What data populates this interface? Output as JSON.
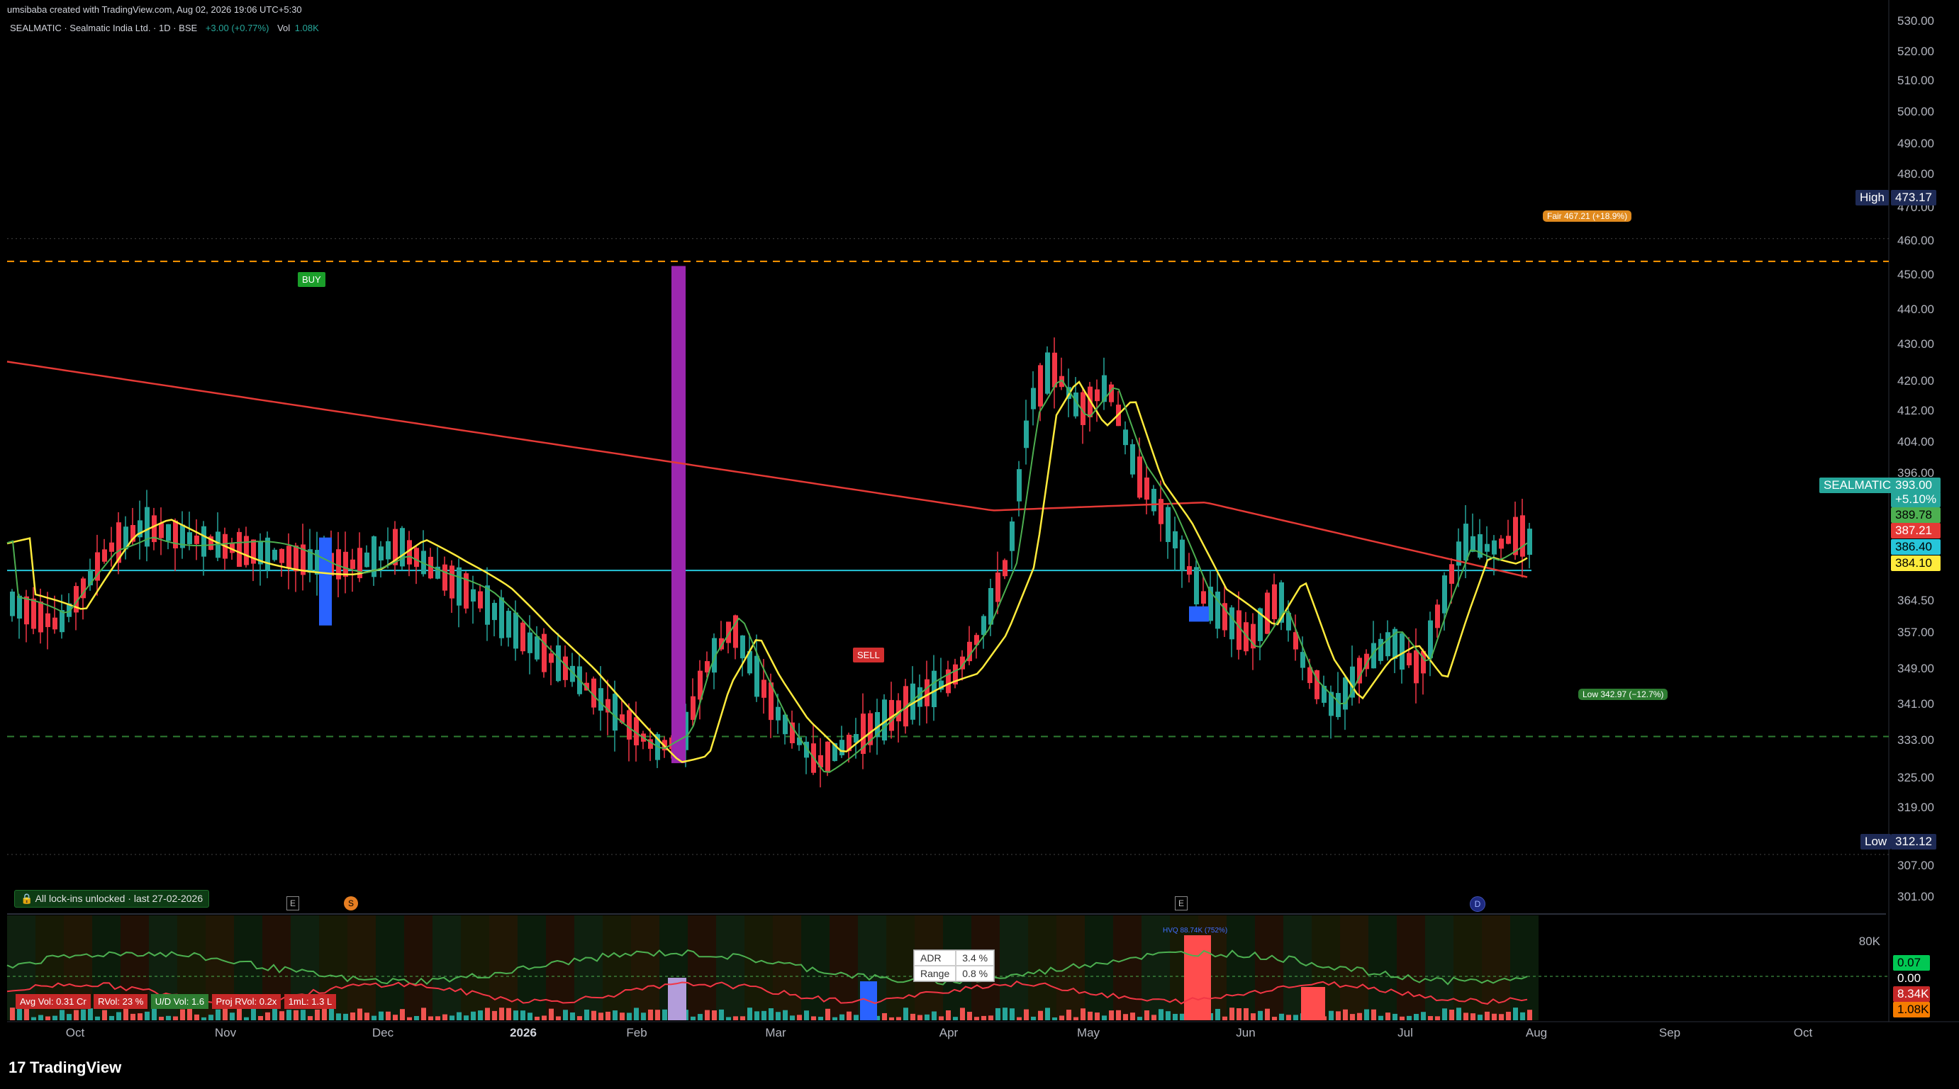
{
  "header": {
    "credit": "umsibaba created with TradingView.com, Aug 02, 2026 19:06 UTC+5:30",
    "symbol": "SEALMATIC · Sealmatic India Ltd. · 1D · BSE",
    "change": "+3.00 (+0.77%)",
    "vol_label": "Vol",
    "vol_value": "1.08K"
  },
  "colors": {
    "up": "#26a69a",
    "down": "#f23645",
    "sma_slow": "#e53935",
    "sma_fast": "#ffeb3b",
    "ema": "#4caf50",
    "hline": "#26c6da",
    "fair": "#ff9800",
    "low_line": "#2e7d32",
    "purple": "#9c27b0",
    "blue": "#2962ff",
    "lavender": "#b39ddb"
  },
  "price_axis": {
    "ticks": [
      "530.00",
      "520.00",
      "510.00",
      "500.00",
      "490.00",
      "480.00",
      "470.00",
      "460.00",
      "450.00",
      "440.00",
      "430.00",
      "420.00",
      "412.00",
      "404.00",
      "396.00",
      "364.50",
      "357.00",
      "349.00",
      "341.00",
      "333.00",
      "325.00",
      "319.00",
      "307.00",
      "301.00"
    ]
  },
  "time_axis": {
    "labels": [
      "Oct",
      "Nov",
      "Dec",
      "2026",
      "Feb",
      "Mar",
      "Apr",
      "May",
      "Jun",
      "Jul",
      "Aug",
      "Sep",
      "Oct"
    ]
  },
  "tags": {
    "high_label": "High",
    "high_value": "473.17",
    "low_label": "Low",
    "low_value": "312.12",
    "sym_label": "SEALMATIC",
    "sym_price": "393.00",
    "sym_change": "+5.10%",
    "ema_value": "389.78",
    "sma_slow_value": "387.21",
    "hline_value": "386.40",
    "sma_fast_value": "384.10",
    "fair": "Fair 467.21 (+18.9%)",
    "low_line": "Low 342.97 (−12.7%)",
    "buy": "BUY",
    "sell": "SELL"
  },
  "events": {
    "lock": "All lock-ins unlocked · last 27-02-2026",
    "earnings": "E",
    "dividend": "S",
    "other": "D"
  },
  "volume_pane": {
    "ticks": [
      "80K",
      "0.07",
      "0.00",
      "8.34K",
      "1.08K"
    ],
    "badges": {
      "avg_vol": "Avg Vol: 0.31 Cr",
      "rvol": "RVol: 23 %",
      "ud_vol": "U/D Vol: 1.6",
      "proj_rvol": "Proj RVol: 0.2x",
      "iml": "1mL: 1.3 L"
    },
    "hvq": "HVQ 88.74K (752%)",
    "adr_label": "ADR",
    "adr_value": "3.4 %",
    "range_label": "Range",
    "range_value": "0.8 %"
  },
  "footer": {
    "brand": "TradingView"
  },
  "chart_data": {
    "type": "line",
    "title": "SEALMATIC · Sealmatic India Ltd. · 1D · BSE",
    "x": [
      "Oct",
      "Nov",
      "Dec",
      "2026",
      "Feb",
      "Mar",
      "Apr",
      "May",
      "Jun",
      "Jul",
      "Aug"
    ],
    "ylim": [
      301,
      530
    ],
    "grid": false,
    "series": [
      {
        "name": "SEALMATIC",
        "values": [
          370,
          400,
          395,
          375,
          350,
          340,
          360,
          440,
          390,
          365,
          393
        ]
      }
    ],
    "levels": {
      "high": 473.17,
      "low": 312.12,
      "fair": 467.21,
      "low_line": 342.97
    }
  }
}
